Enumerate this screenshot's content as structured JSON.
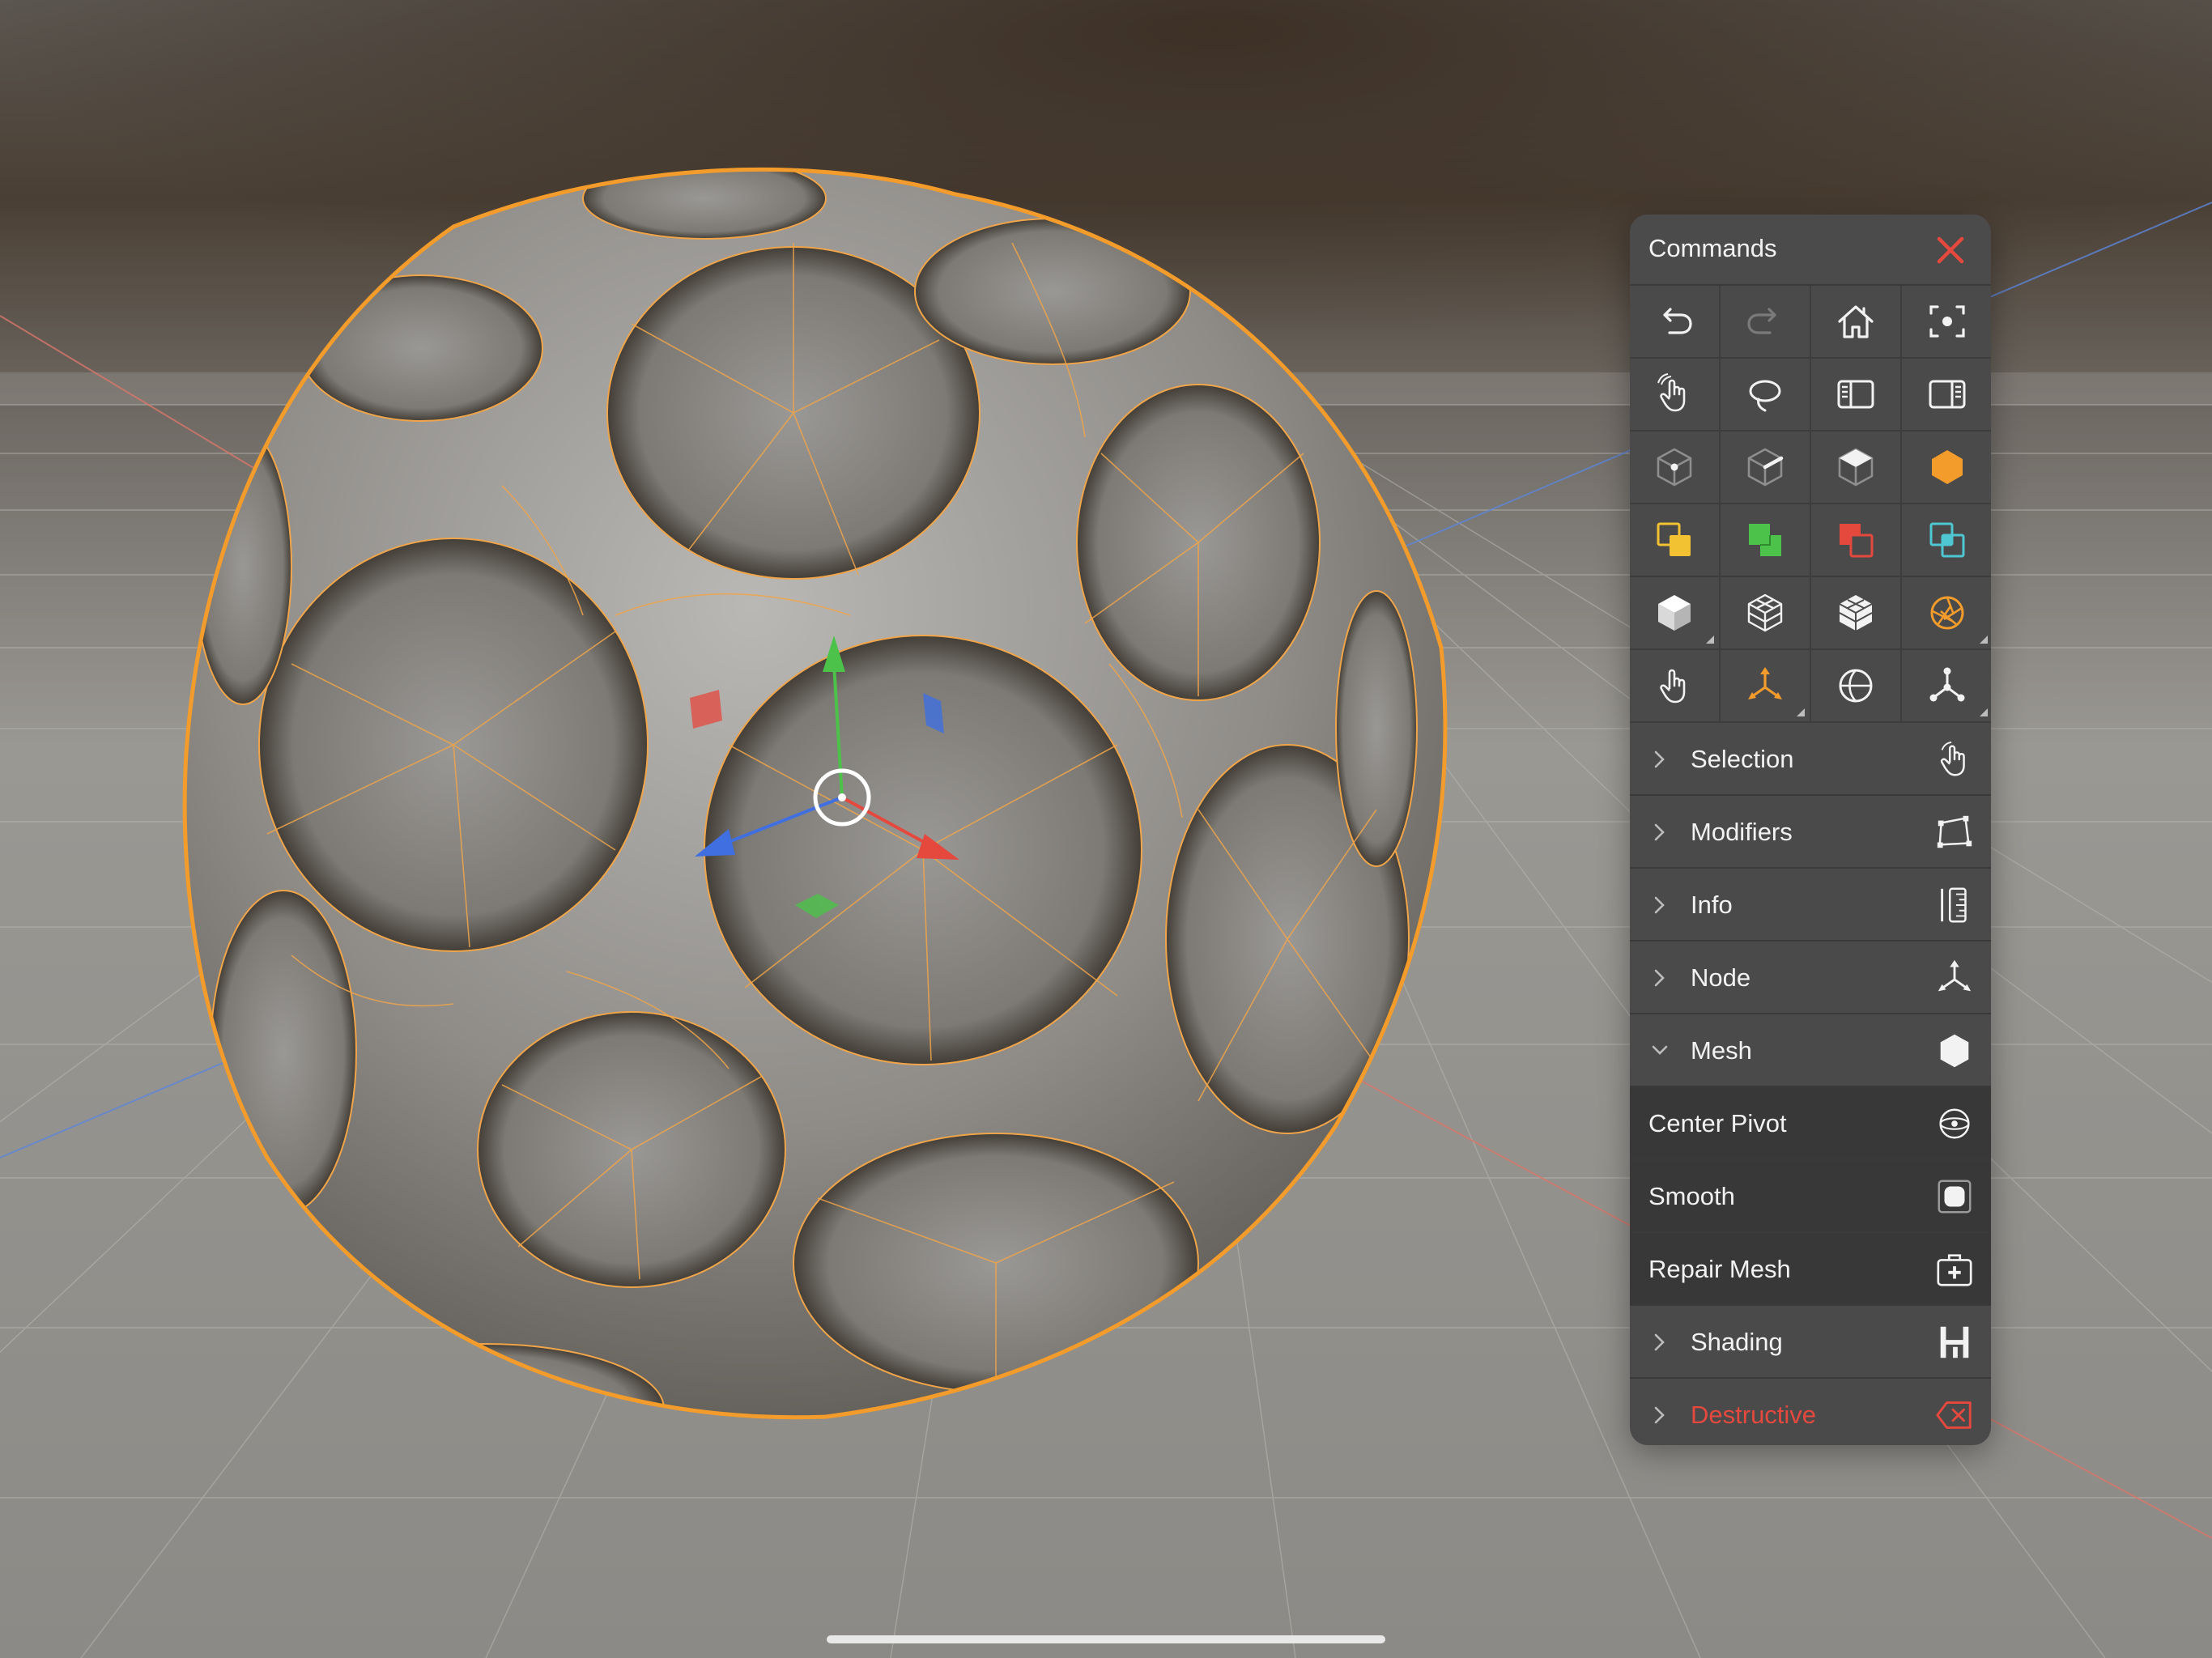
{
  "panel": {
    "title": "Commands",
    "toolbar_rows": [
      [
        "undo-icon",
        "redo-icon",
        "home-icon",
        "frame-selection-icon"
      ],
      [
        "touch-select-icon",
        "lasso-icon",
        "left-panel-icon",
        "right-panel-icon"
      ],
      [
        "vertex-mode-icon",
        "edge-mode-icon",
        "face-mode-icon",
        "object-mode-icon"
      ],
      [
        "boolean-union-icon",
        "boolean-merge-icon",
        "boolean-subtract-icon",
        "boolean-intersect-icon"
      ],
      [
        "cube-solid-icon",
        "cube-wire-icon",
        "cube-shaded-icon",
        "snap-aperture-icon"
      ],
      [
        "touch-hand-icon",
        "transform-gizmo-icon",
        "globe-icon",
        "node-graph-icon"
      ]
    ],
    "sections": {
      "selection": "Selection",
      "modifiers": "Modifiers",
      "info": "Info",
      "node": "Node",
      "mesh": "Mesh",
      "shading": "Shading",
      "destructive": "Destructive"
    },
    "mesh_items": {
      "center_pivot": "Center Pivot",
      "smooth": "Smooth",
      "repair_mesh": "Repair Mesh"
    }
  },
  "colors": {
    "panel_bg": "#4a4a4a",
    "selection_outline": "#f39c2b",
    "danger": "#e5483d",
    "axis_x": "#e5483d",
    "axis_y": "#4cc24a",
    "axis_z": "#3f6fe0"
  }
}
